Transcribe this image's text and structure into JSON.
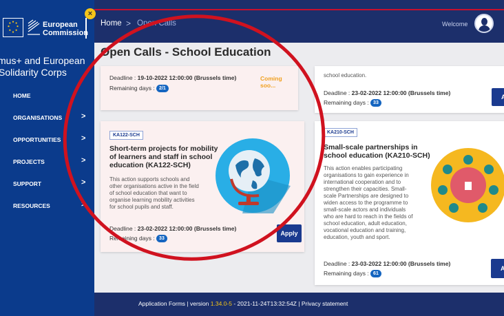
{
  "sidebar": {
    "logo_line1": "European",
    "logo_line2": "Commission",
    "app_name_line1": "smus+ and European",
    "app_name_line2": "Solidarity Corps",
    "items": [
      {
        "label": "HOME",
        "chevron": ""
      },
      {
        "label": "ORGANISATIONS",
        "chevron": ">"
      },
      {
        "label": "OPPORTUNITIES",
        "chevron": ">"
      },
      {
        "label": "PROJECTS",
        "chevron": ">"
      },
      {
        "label": "SUPPORT",
        "chevron": ">"
      },
      {
        "label": "RESOURCES",
        "chevron": ">"
      }
    ],
    "collapse_icon": "×"
  },
  "topbar": {
    "breadcrumb_home": "Home",
    "breadcrumb_sep": ">",
    "breadcrumb_current": "Open Calls",
    "welcome": "Welcome"
  },
  "main": {
    "title": "Open Calls - School Education",
    "card_top_left": {
      "deadline_label": "Deadline :",
      "deadline_value": "19-10-2022 12:00:00 (Brussels time)",
      "remaining_label": "Remaining days :",
      "remaining_value": "2/1",
      "status": "Coming soo..."
    },
    "card_top_right": {
      "desc_tail": "school education.",
      "deadline_label": "Deadline :",
      "deadline_value": "23-02-2022 12:00:00 (Brussels time)",
      "remaining_label": "Remaining days :",
      "remaining_value": "33",
      "apply": "Ap"
    },
    "card_ka122": {
      "tag": "KA122-SCH",
      "title_line1": "Short-term projects for mobility",
      "title_line2": "of learners and staff in school",
      "title_line3": "education (KA122-SCH)",
      "desc_lines": [
        "This action supports schools and",
        "other organisations active in the field",
        "of school education that want to",
        "organise learning mobility activities",
        "for school pupils and staff."
      ],
      "deadline_label": "Deadline :",
      "deadline_value": "23-02-2022 12:00:00 (Brussels time)",
      "remaining_label": "Remaining days :",
      "remaining_value": "33",
      "apply": "Apply"
    },
    "card_ka210": {
      "tag": "KA210-SCH",
      "title_line1": "Small-scale partnerships in",
      "title_line2": "school education (KA210-SCH)",
      "desc_lines": [
        "This action enables participating",
        "organisations to gain experience in",
        "international cooperation and to",
        "strengthen their capacities. Small-",
        "scale Partnerships are designed to",
        "widen access to the programme to",
        "small-scale actors and individuals",
        "who are hard to reach in the fields of",
        "school education, adult education,",
        "vocational education and training,",
        "education, youth and sport."
      ],
      "deadline_label": "Deadline :",
      "deadline_value": "23-03-2022 12:00:00 (Brussels time)",
      "remaining_label": "Remaining days :",
      "remaining_value": "61",
      "apply": "Ap"
    }
  },
  "footer": {
    "forms": "Application Forms",
    "sep1": "|",
    "version_label": "version",
    "version_value": "1.34.0-5",
    "build": "- 2021-11-24T13:32:54Z",
    "sep2": "|",
    "privacy": "Privacy statement"
  },
  "colors": {
    "sidebar": "#0b3b8c",
    "topbar": "#1c2f6b",
    "accent_red": "#c8102e",
    "status_orange": "#f0a020",
    "apply_blue": "#1a3a8f"
  }
}
